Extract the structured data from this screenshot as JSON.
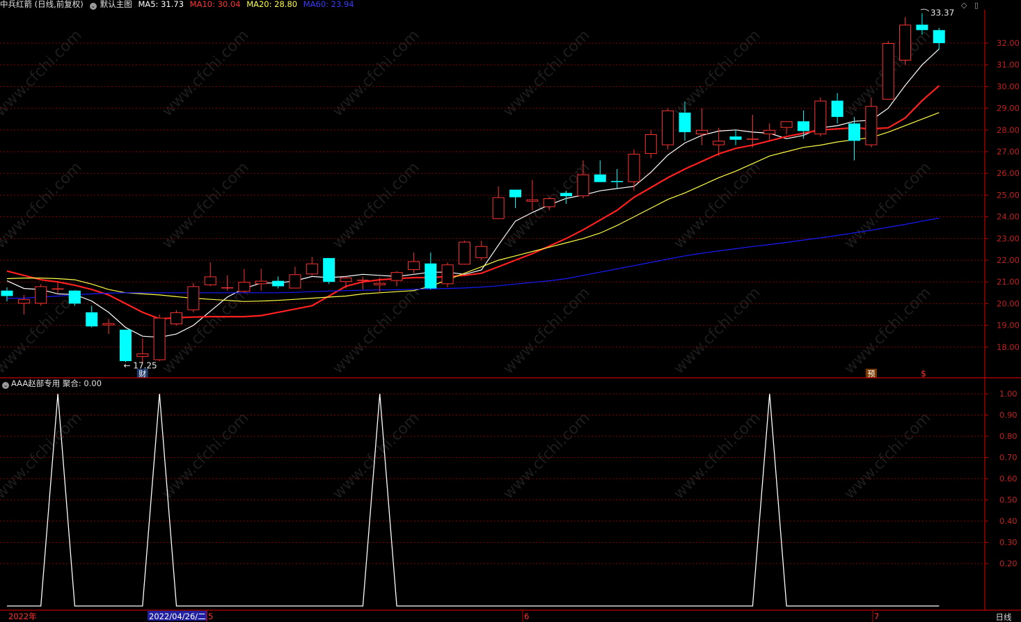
{
  "header": {
    "stock_title": "中兵红箭 (日线,前复权)",
    "main_chart_label": "默认主图",
    "ma5_label": "MA5: 31.73",
    "ma10_label": "MA10: 30.04",
    "ma20_label": "MA20: 28.80",
    "ma60_label": "MA60: 23.94",
    "diamond_icon": "◇",
    "panel_icon": "▯"
  },
  "sub_header": {
    "indicator_label": "AAA赵部专用",
    "value_label": "聚合: 0.00"
  },
  "colors": {
    "up": "#ff3333",
    "down": "#00ffff",
    "ma5": "#ffffff",
    "ma10": "#ff2020",
    "ma20": "#ffff44",
    "ma60": "#1a1aff",
    "grid": "#8a0000",
    "axis": "#c00000"
  },
  "annotations": {
    "high": "33.37",
    "low": "17.25",
    "fin_badge": "财",
    "pre_badge": "预",
    "dollar_badge": "$",
    "watermark": "www.cfchi.com"
  },
  "bottom_bar": {
    "year_label": "2022年",
    "date_cursor": "2022/04/26/二",
    "month_5": "5",
    "month_6": "6",
    "month_7": "7",
    "period_tab": "日线"
  },
  "chart_data": [
    {
      "type": "candlestick",
      "title": "中兵红箭 (日线,前复权)",
      "y_ticks": [
        18,
        19,
        20,
        21,
        22,
        23,
        24,
        25,
        26,
        27,
        28,
        29,
        30,
        31,
        32
      ],
      "y_tick_labels": [
        "18.00",
        "19.00",
        "20.00",
        "21.00",
        "22.00",
        "23.00",
        "24.00",
        "25.00",
        "26.00",
        "27.00",
        "28.00",
        "29.00",
        "30.00",
        "31.00",
        "32.00"
      ],
      "ylim": [
        16.55,
        34.03
      ],
      "candles": [
        {
          "o": 20.6,
          "h": 20.75,
          "l": 20.1,
          "c": 20.35
        },
        {
          "o": 20,
          "h": 20.4,
          "l": 19.5,
          "c": 20.2
        },
        {
          "o": 20,
          "h": 20.9,
          "l": 19.9,
          "c": 20.8
        },
        {
          "o": 20.65,
          "h": 21.05,
          "l": 20.5,
          "c": 20.7
        },
        {
          "o": 20.6,
          "h": 20.6,
          "l": 19.9,
          "c": 20
        },
        {
          "o": 19.6,
          "h": 19.9,
          "l": 18.9,
          "c": 18.95
        },
        {
          "o": 19,
          "h": 19.3,
          "l": 18.6,
          "c": 19.1
        },
        {
          "o": 18.8,
          "h": 18.8,
          "l": 17.3,
          "c": 17.35
        },
        {
          "o": 17.55,
          "h": 18.4,
          "l": 17.3,
          "c": 17.7
        },
        {
          "o": 17.4,
          "h": 19.5,
          "l": 17.35,
          "c": 19.35
        },
        {
          "o": 19.05,
          "h": 19.7,
          "l": 19,
          "c": 19.6
        },
        {
          "o": 19.7,
          "h": 20.95,
          "l": 19.6,
          "c": 20.8
        },
        {
          "o": 20.85,
          "h": 21.9,
          "l": 20.8,
          "c": 21.25
        },
        {
          "o": 20.75,
          "h": 21.3,
          "l": 20.6,
          "c": 20.75
        },
        {
          "o": 20.55,
          "h": 21.6,
          "l": 20.5,
          "c": 21
        },
        {
          "o": 20.9,
          "h": 21.6,
          "l": 20.6,
          "c": 21.05
        },
        {
          "o": 21.05,
          "h": 21.25,
          "l": 20.7,
          "c": 20.8
        },
        {
          "o": 20.7,
          "h": 21.7,
          "l": 20.7,
          "c": 21.35
        },
        {
          "o": 21.35,
          "h": 22.15,
          "l": 21.3,
          "c": 21.85
        },
        {
          "o": 22.1,
          "h": 22.1,
          "l": 20.9,
          "c": 21
        },
        {
          "o": 21,
          "h": 21.25,
          "l": 20.7,
          "c": 21.2
        },
        {
          "o": 21.05,
          "h": 21.25,
          "l": 20.65,
          "c": 21.1
        },
        {
          "o": 20.85,
          "h": 21.2,
          "l": 20.5,
          "c": 20.95
        },
        {
          "o": 21.05,
          "h": 21.5,
          "l": 20.8,
          "c": 21.45
        },
        {
          "o": 21.55,
          "h": 22.35,
          "l": 21.4,
          "c": 21.95
        },
        {
          "o": 21.85,
          "h": 22.35,
          "l": 20.65,
          "c": 20.7
        },
        {
          "o": 20.9,
          "h": 21.9,
          "l": 20.75,
          "c": 21.8
        },
        {
          "o": 21.8,
          "h": 22.9,
          "l": 21.8,
          "c": 22.85
        },
        {
          "o": 22.1,
          "h": 22.9,
          "l": 22,
          "c": 22.65
        },
        {
          "o": 23.9,
          "h": 25.4,
          "l": 23.9,
          "c": 24.9
        },
        {
          "o": 25.25,
          "h": 25.25,
          "l": 24.4,
          "c": 24.9
        },
        {
          "o": 24.7,
          "h": 25.7,
          "l": 24.3,
          "c": 24.8
        },
        {
          "o": 24.45,
          "h": 24.9,
          "l": 24.3,
          "c": 24.85
        },
        {
          "o": 25.1,
          "h": 25.2,
          "l": 24.6,
          "c": 24.95
        },
        {
          "o": 24.95,
          "h": 26.6,
          "l": 24.85,
          "c": 25.95
        },
        {
          "o": 25.95,
          "h": 26.6,
          "l": 25.6,
          "c": 25.6
        },
        {
          "o": 25.65,
          "h": 26.2,
          "l": 25.3,
          "c": 25.6
        },
        {
          "o": 25.6,
          "h": 27.1,
          "l": 25.2,
          "c": 26.9
        },
        {
          "o": 26.9,
          "h": 28,
          "l": 26.7,
          "c": 27.8
        },
        {
          "o": 27.3,
          "h": 29,
          "l": 27.1,
          "c": 28.9
        },
        {
          "o": 28.8,
          "h": 29.3,
          "l": 27.5,
          "c": 27.9
        },
        {
          "o": 27.8,
          "h": 29,
          "l": 27.3,
          "c": 28
        },
        {
          "o": 27.3,
          "h": 28.1,
          "l": 26.8,
          "c": 27.5
        },
        {
          "o": 27.7,
          "h": 28,
          "l": 27.3,
          "c": 27.55
        },
        {
          "o": 27.6,
          "h": 28.7,
          "l": 27.2,
          "c": 27.6
        },
        {
          "o": 27.8,
          "h": 28.3,
          "l": 27.5,
          "c": 28
        },
        {
          "o": 28.1,
          "h": 28.4,
          "l": 27.8,
          "c": 28.4
        },
        {
          "o": 28.4,
          "h": 28.9,
          "l": 27.6,
          "c": 27.95
        },
        {
          "o": 27.8,
          "h": 29.5,
          "l": 27.7,
          "c": 29.35
        },
        {
          "o": 29.35,
          "h": 29.7,
          "l": 28.3,
          "c": 28.6
        },
        {
          "o": 28.3,
          "h": 28.6,
          "l": 26.6,
          "c": 27.5
        },
        {
          "o": 27.3,
          "h": 29.5,
          "l": 27.2,
          "c": 29.1
        },
        {
          "o": 29.4,
          "h": 32.1,
          "l": 29.4,
          "c": 32
        },
        {
          "o": 31.2,
          "h": 33.2,
          "l": 31,
          "c": 32.85
        },
        {
          "o": 32.85,
          "h": 33.37,
          "l": 32.4,
          "c": 32.6
        },
        {
          "o": 32.6,
          "h": 32.7,
          "l": 31.7,
          "c": 32
        }
      ],
      "ma": [
        {
          "name": "MA5",
          "values": [
            21.05,
            20.7,
            20.65,
            20.45,
            20.42,
            20.12,
            19.6,
            18.9,
            18.5,
            18.45,
            18.6,
            19.0,
            19.65,
            20.3,
            20.7,
            20.95,
            20.95,
            21.05,
            21.25,
            21.2,
            21.25,
            21.35,
            21.3,
            21.25,
            21.35,
            21.45,
            21.45,
            21.35,
            21.55,
            22.7,
            23.8,
            24.2,
            24.55,
            24.85,
            25.0,
            25.2,
            25.3,
            25.4,
            26.05,
            26.85,
            27.4,
            27.75,
            27.95,
            28.0,
            27.9,
            27.85,
            27.6,
            27.75,
            28.1,
            28.2,
            28.4,
            28.45,
            29.0,
            30.05,
            31.0,
            31.73
          ]
        },
        {
          "name": "MA10",
          "values": [
            21.5,
            21.3,
            21.1,
            21.0,
            20.85,
            20.65,
            20.4,
            20.0,
            19.6,
            19.3,
            19.35,
            19.38,
            19.4,
            19.4,
            19.4,
            19.45,
            19.6,
            19.75,
            19.9,
            20.35,
            20.8,
            21.0,
            21.1,
            21.15,
            21.2,
            21.2,
            21.25,
            21.3,
            21.4,
            21.7,
            22.0,
            22.3,
            22.65,
            23.0,
            23.4,
            23.85,
            24.3,
            24.9,
            25.35,
            25.8,
            26.2,
            26.55,
            26.9,
            27.15,
            27.3,
            27.5,
            27.7,
            27.85,
            28.0,
            28.05,
            28.1,
            28.05,
            28.1,
            28.55,
            29.35,
            30.04
          ]
        },
        {
          "name": "MA20",
          "values": [
            21.15,
            21.18,
            21.18,
            21.15,
            21.1,
            20.9,
            20.65,
            20.5,
            20.45,
            20.4,
            20.32,
            20.25,
            20.2,
            20.15,
            20.1,
            20.12,
            20.15,
            20.2,
            20.25,
            20.3,
            20.35,
            20.45,
            20.5,
            20.55,
            20.6,
            20.8,
            21.1,
            21.4,
            21.7,
            22.0,
            22.2,
            22.4,
            22.6,
            22.8,
            23.0,
            23.25,
            23.6,
            24.0,
            24.4,
            24.8,
            25.1,
            25.45,
            25.8,
            26.1,
            26.45,
            26.8,
            27.0,
            27.2,
            27.3,
            27.45,
            27.55,
            27.65,
            27.9,
            28.2,
            28.5,
            28.8
          ]
        },
        {
          "name": "MA60",
          "values": [
            20.25,
            20.25,
            20.3,
            20.35,
            20.4,
            20.45,
            20.48,
            20.5,
            20.5,
            20.5,
            20.5,
            20.5,
            20.5,
            20.5,
            20.5,
            20.5,
            20.5,
            20.52,
            20.55,
            20.58,
            20.6,
            20.62,
            20.63,
            20.64,
            20.66,
            20.68,
            20.7,
            20.72,
            20.76,
            20.82,
            20.9,
            20.98,
            21.05,
            21.15,
            21.3,
            21.45,
            21.6,
            21.75,
            21.9,
            22.05,
            22.2,
            22.32,
            22.43,
            22.53,
            22.63,
            22.72,
            22.82,
            22.93,
            23.03,
            23.14,
            23.26,
            23.38,
            23.52,
            23.65,
            23.8,
            23.94
          ]
        }
      ]
    },
    {
      "type": "line",
      "title": "AAA赵部专用",
      "y_ticks": [
        0.2,
        0.3,
        0.4,
        0.5,
        0.6,
        0.7,
        0.8,
        0.9,
        1.0
      ],
      "y_tick_labels": [
        "0.20",
        "0.30",
        "0.40",
        "0.50",
        "0.60",
        "0.70",
        "0.80",
        "0.90",
        "1.00"
      ],
      "ylim": [
        0,
        1
      ],
      "series": [
        {
          "values": [
            0,
            0,
            0,
            1,
            0,
            0,
            0,
            0,
            0,
            1,
            0,
            0,
            0,
            0,
            0,
            0,
            0,
            0,
            0,
            0,
            0,
            0,
            1,
            0,
            0,
            0,
            0,
            0,
            0,
            0,
            0,
            0,
            0,
            0,
            0,
            0,
            0,
            0,
            0,
            0,
            0,
            0,
            0,
            0,
            0,
            1,
            0,
            0,
            0,
            0,
            0,
            0,
            0,
            0,
            0,
            0
          ]
        }
      ]
    }
  ]
}
